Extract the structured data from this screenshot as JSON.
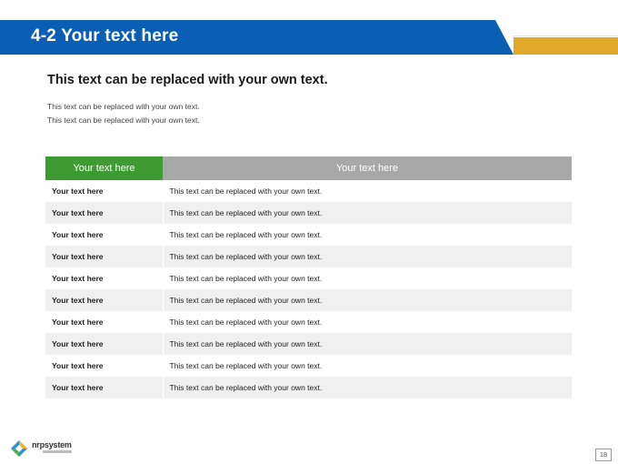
{
  "slide": {
    "title": "4-2 Your text here",
    "subtitle": "This text can be replaced with your own text.",
    "body_lines": [
      "This text can be replaced with your own text.",
      "This text can be replaced with your own text."
    ],
    "page_number": "18"
  },
  "table": {
    "headers": [
      "Your text here",
      "Your text here"
    ],
    "rows": [
      [
        "Your text here",
        "This text can be replaced with your own text."
      ],
      [
        "Your text here",
        "This text can be replaced with your own text."
      ],
      [
        "Your text here",
        "This text can be replaced with your own text."
      ],
      [
        "Your text here",
        "This text can be replaced with your own text."
      ],
      [
        "Your text here",
        "This text can be replaced with your own text."
      ],
      [
        "Your text here",
        "This text can be replaced with your own text."
      ],
      [
        "Your text here",
        "This text can be replaced with your own text."
      ],
      [
        "Your text here",
        "This text can be replaced with your own text."
      ],
      [
        "Your text here",
        "This text can be replaced with your own text."
      ],
      [
        "Your text here",
        "This text can be replaced with your own text."
      ]
    ]
  },
  "logo": {
    "name": "nrpsystem",
    "icon": "nrpsystem-logo-icon"
  },
  "colors": {
    "title_bar": "#0a5fb4",
    "accent_gold": "#e0a92a",
    "header_green": "#3f9a33",
    "header_gray": "#a8a8a8",
    "row_shade": "#f0f0f0"
  }
}
